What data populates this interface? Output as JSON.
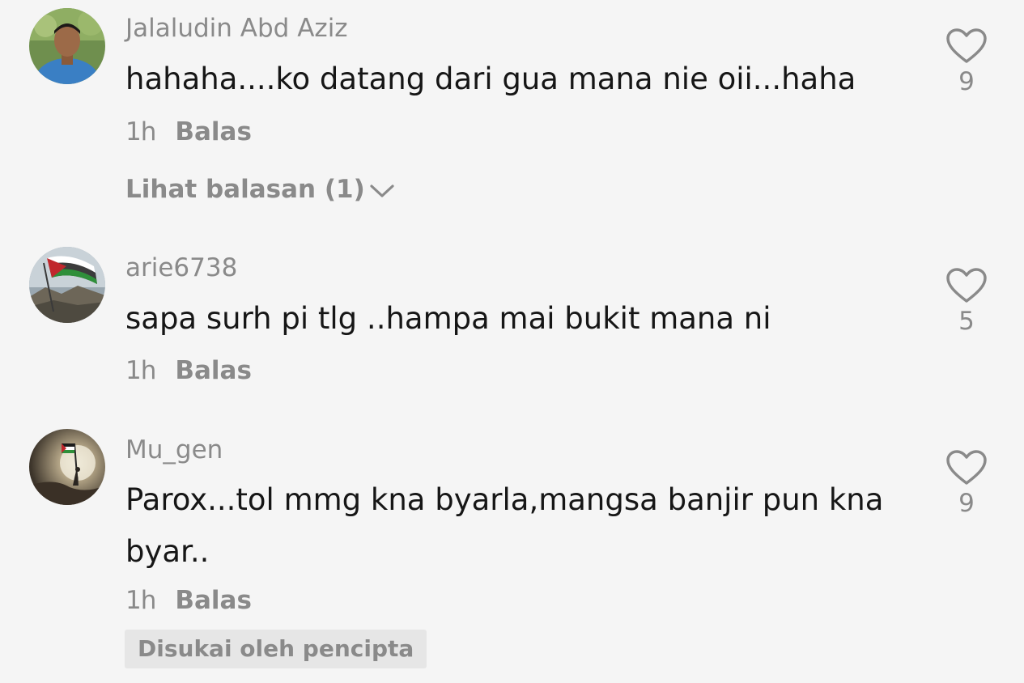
{
  "comments": [
    {
      "username": "Jalaludin Abd Aziz",
      "text": "hahaha....ko datang dari gua mana nie oii...haha",
      "time": "1h",
      "reply_label": "Balas",
      "likes": "9",
      "view_replies": "Lihat balasan (1)"
    },
    {
      "username": "arie6738",
      "text": "sapa surh pi tlg ..hampa mai bukit mana ni",
      "time": "1h",
      "reply_label": "Balas",
      "likes": "5"
    },
    {
      "username": "Mu_gen",
      "text": "Parox...tol mmg kna byarla,mangsa banjir pun kna byar..",
      "time": "1h",
      "reply_label": "Balas",
      "likes": "9",
      "badge": "Disukai oleh pencipta"
    }
  ],
  "colors": {
    "background": "#f5f5f5",
    "text_primary": "#161616",
    "text_secondary": "#8a8a8a",
    "badge_bg": "#e6e6e6"
  },
  "icons": {
    "like": "heart-outline-icon",
    "expand": "chevron-down-icon"
  }
}
